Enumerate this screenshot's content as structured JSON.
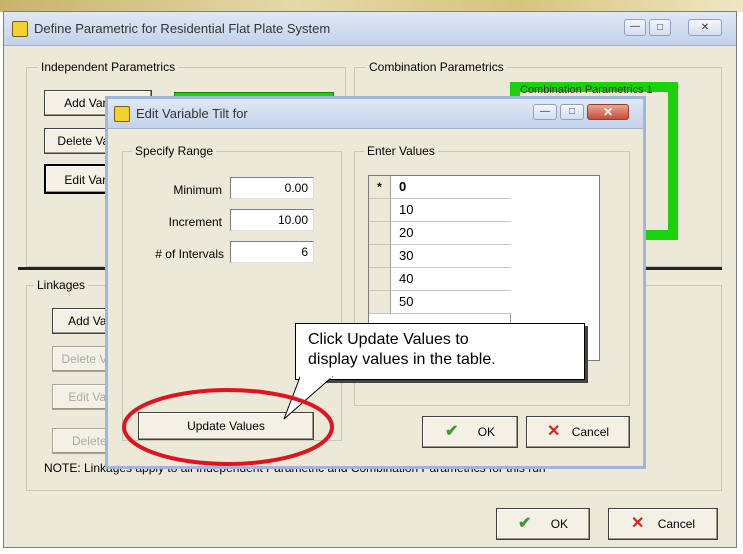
{
  "main_dialog": {
    "title": "Define Parametric for Residential Flat Plate System",
    "caption_min": "—",
    "caption_max": "□",
    "caption_close": "✕",
    "independent_group": "Independent Parametrics",
    "combination_group": "Combination Parametrics",
    "add_variable_button": "Add Variable",
    "delete_variable_button": "Delete Variable",
    "edit_variable_button": "Edit Variable",
    "combination_item": "Combination Parametrics 1",
    "linkages_group": "Linkages",
    "link_add_button": "Add Variable",
    "link_delete_button": "Delete Variable",
    "link_edit_button": "Edit Variable",
    "link_delete2_button": "Delete Link",
    "note_text": "NOTE: Linkages apply to all Independent Parametric and Combination Parametrics for this run",
    "ok_label": "OK",
    "cancel_label": "Cancel"
  },
  "edit_dialog": {
    "title": "Edit Variable Tilt for",
    "specify_range_group": "Specify Range",
    "minimum_label": "Minimum",
    "minimum_value": "0.00",
    "increment_label": "Increment",
    "increment_value": "10.00",
    "intervals_label": "# of Intervals",
    "intervals_value": "6",
    "update_button": "Update Values",
    "enter_values_group": "Enter Values",
    "row_marker": "*",
    "values": [
      "0",
      "10",
      "20",
      "30",
      "40",
      "50"
    ],
    "ok_label": "OK",
    "cancel_label": "Cancel"
  },
  "callout": {
    "text_line1": "Click Update Values to",
    "text_line2": "display values in the table."
  },
  "colors": {
    "highlight_green": "#19d20c",
    "annotation_red": "#e0141e",
    "dialog_bg": "#ece9d8",
    "close_red": "#c94d35"
  }
}
